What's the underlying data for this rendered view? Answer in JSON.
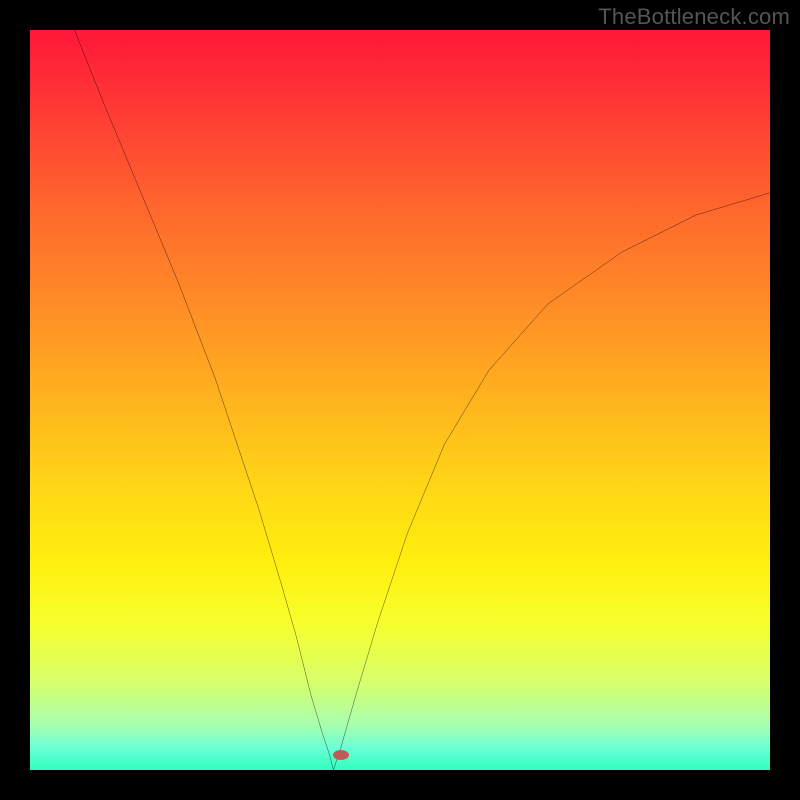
{
  "watermark": "TheBottleneck.com",
  "chart_data": {
    "type": "line",
    "title": "",
    "xlabel": "",
    "ylabel": "",
    "xlim": [
      0,
      100
    ],
    "ylim": [
      0,
      100
    ],
    "gradient_stops": [
      {
        "pct": 0,
        "color": "#ff1738"
      },
      {
        "pct": 12,
        "color": "#ff3e34"
      },
      {
        "pct": 25,
        "color": "#ff6a2c"
      },
      {
        "pct": 38,
        "color": "#ff8f26"
      },
      {
        "pct": 50,
        "color": "#ffb31e"
      },
      {
        "pct": 62,
        "color": "#ffd716"
      },
      {
        "pct": 72,
        "color": "#ffef0e"
      },
      {
        "pct": 80,
        "color": "#f7ff2c"
      },
      {
        "pct": 88,
        "color": "#d8ff6a"
      },
      {
        "pct": 94,
        "color": "#a6ffb0"
      },
      {
        "pct": 97,
        "color": "#6cffd6"
      },
      {
        "pct": 100,
        "color": "#30ffc0"
      }
    ],
    "series": [
      {
        "name": "left-branch",
        "x": [
          6,
          10,
          15,
          20,
          25,
          28,
          31,
          34,
          36,
          38,
          39.5,
          40.5,
          41
        ],
        "y": [
          100,
          90,
          78,
          66,
          53,
          44,
          35,
          25,
          18,
          10,
          5,
          2,
          0
        ]
      },
      {
        "name": "right-branch",
        "x": [
          41,
          42,
          44,
          47,
          51,
          56,
          62,
          70,
          80,
          90,
          100
        ],
        "y": [
          0,
          3,
          10,
          20,
          32,
          44,
          54,
          63,
          70,
          75,
          78
        ]
      }
    ],
    "marker": {
      "x": 42,
      "y": 2,
      "color": "#c25b57"
    }
  }
}
